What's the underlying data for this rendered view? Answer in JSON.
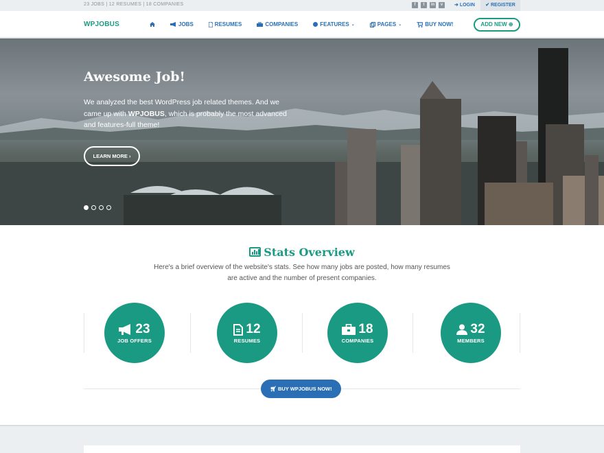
{
  "topbar": {
    "counts": "23 JOBS | 12 RESUMES | 18 COMPANIES",
    "socials": [
      "facebook-icon",
      "twitter-icon",
      "linkedin-icon",
      "vimeo-icon"
    ],
    "login": "LOGIN",
    "register": "REGISTER"
  },
  "header": {
    "logo": "WPJOBUS",
    "nav": [
      {
        "label": "",
        "icon": "home-icon"
      },
      {
        "label": "JOBS",
        "icon": "megaphone-icon"
      },
      {
        "label": "RESUMES",
        "icon": "file-icon"
      },
      {
        "label": "COMPANIES",
        "icon": "briefcase-icon"
      },
      {
        "label": "FEATURES",
        "icon": "circle-icon",
        "dropdown": true
      },
      {
        "label": "PAGES",
        "icon": "pages-icon",
        "dropdown": true
      },
      {
        "label": "BUY NOW!",
        "icon": "cart-icon"
      }
    ],
    "add_new": "ADD NEW"
  },
  "hero": {
    "title": "Awesome Job!",
    "desc_before": "We analyzed the best WordPress job related themes. And we came up with ",
    "desc_bold": "WPJOBUS",
    "desc_after": ", which is probably the most advanced and features-full theme!",
    "learn_more": "LEARN MORE",
    "slides": 4,
    "active_slide": 1
  },
  "stats": {
    "title": "Stats Overview",
    "description": "Here's a brief overview of the website's stats. See how many jobs are posted, how many resumes are active and the number of present companies.",
    "items": [
      {
        "value": "23",
        "label": "JOB OFFERS",
        "icon": "megaphone-icon"
      },
      {
        "value": "12",
        "label": "RESUMES",
        "icon": "file-icon"
      },
      {
        "value": "18",
        "label": "COMPANIES",
        "icon": "briefcase-icon"
      },
      {
        "value": "32",
        "label": "MEMBERS",
        "icon": "user-icon"
      }
    ],
    "buy_button": "BUY WPJOBUS NOW!"
  },
  "colors": {
    "accent": "#1a9a82",
    "link": "#2a6fb6",
    "topbar": "#eceff1"
  }
}
